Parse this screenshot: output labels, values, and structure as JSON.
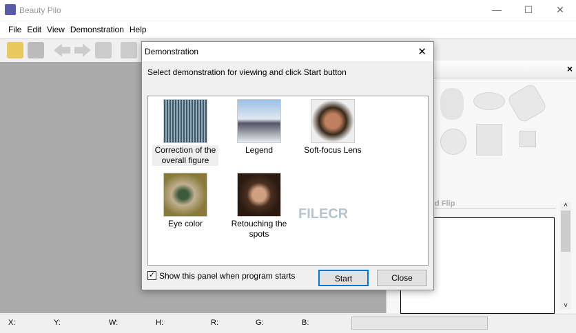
{
  "app": {
    "title": "Beauty Pilo"
  },
  "window_controls": {
    "minimize": "—",
    "maximize": "☐",
    "close": "✕"
  },
  "menu": [
    "File",
    "Edit",
    "View",
    "Demonstration",
    "Help"
  ],
  "right_panel": {
    "close": "×",
    "section_label": "d Flip",
    "scroll_up": "˄",
    "scroll_down": "˅"
  },
  "status": {
    "x": "X:",
    "y": "Y:",
    "w": "W:",
    "h": "H:",
    "r": "R:",
    "g": "G:",
    "b": "B:"
  },
  "dialog": {
    "title": "Demonstration",
    "close": "✕",
    "instruction": "Select demonstration for viewing and click Start button",
    "items": [
      {
        "label": "Correction of the overall figure",
        "color": "#5a7a8a"
      },
      {
        "label": "Legend",
        "color": "#6a8fb0"
      },
      {
        "label": "Soft-focus Lens",
        "color": "#8a5a3a"
      },
      {
        "label": "Eye color",
        "color": "#7a8a4a"
      },
      {
        "label": "Retouching the spots",
        "color": "#6a4a3a"
      }
    ],
    "checkbox_label": "Show this panel when program starts",
    "checkbox_checked": true,
    "start": "Start",
    "close_button": "Close"
  },
  "watermark": "FILECR"
}
